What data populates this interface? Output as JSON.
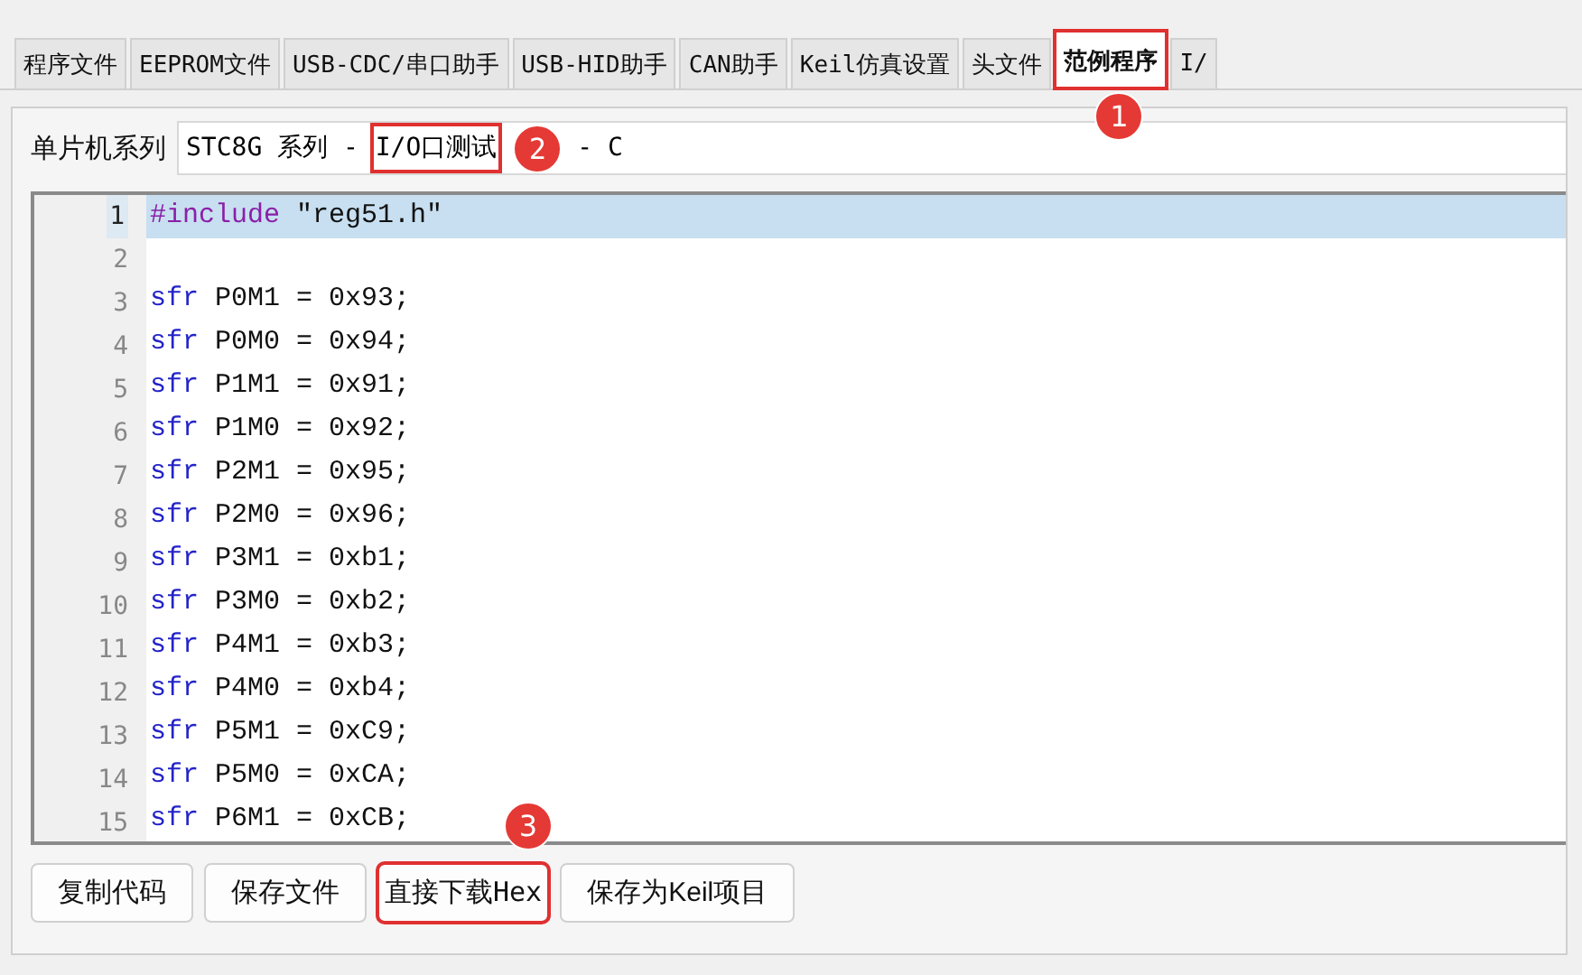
{
  "tabs": [
    {
      "label": "程序文件",
      "selected": false
    },
    {
      "label": "EEPROM文件",
      "selected": false
    },
    {
      "label": "USB-CDC/串口助手",
      "selected": false
    },
    {
      "label": "USB-HID助手",
      "selected": false
    },
    {
      "label": "CAN助手",
      "selected": false
    },
    {
      "label": "Keil仿真设置",
      "selected": false
    },
    {
      "label": "头文件",
      "selected": false
    },
    {
      "label": "范例程序",
      "selected": true,
      "callout": "1"
    },
    {
      "label": "I/",
      "selected": false
    }
  ],
  "series": {
    "label": "单片机系列",
    "parts": [
      {
        "text": "STC8G 系列 - "
      },
      {
        "text": "I/O口测试",
        "callout": "2"
      },
      {
        "text": " - C"
      }
    ]
  },
  "code": [
    {
      "number": "1",
      "selected": true,
      "tokens": [
        {
          "kind": "directive",
          "text": "#include"
        },
        {
          "kind": "plain",
          "text": " \"reg51.h\""
        }
      ]
    },
    {
      "number": "2",
      "selected": false
    },
    {
      "number": "3",
      "selected": false,
      "tokens": [
        {
          "kind": "keyword",
          "text": "sfr"
        },
        {
          "kind": "plain",
          "text": " P0M1 = 0x93;"
        }
      ]
    },
    {
      "number": "4",
      "selected": false,
      "tokens": [
        {
          "kind": "keyword",
          "text": "sfr"
        },
        {
          "kind": "plain",
          "text": " P0M0 = 0x94;"
        }
      ]
    },
    {
      "number": "5",
      "selected": false,
      "tokens": [
        {
          "kind": "keyword",
          "text": "sfr"
        },
        {
          "kind": "plain",
          "text": " P1M1 = 0x91;"
        }
      ]
    },
    {
      "number": "6",
      "selected": false,
      "tokens": [
        {
          "kind": "keyword",
          "text": "sfr"
        },
        {
          "kind": "plain",
          "text": " P1M0 = 0x92;"
        }
      ]
    },
    {
      "number": "7",
      "selected": false,
      "tokens": [
        {
          "kind": "keyword",
          "text": "sfr"
        },
        {
          "kind": "plain",
          "text": " P2M1 = 0x95;"
        }
      ]
    },
    {
      "number": "8",
      "selected": false,
      "tokens": [
        {
          "kind": "keyword",
          "text": "sfr"
        },
        {
          "kind": "plain",
          "text": " P2M0 = 0x96;"
        }
      ]
    },
    {
      "number": "9",
      "selected": false,
      "tokens": [
        {
          "kind": "keyword",
          "text": "sfr"
        },
        {
          "kind": "plain",
          "text": " P3M1 = 0xb1;"
        }
      ]
    },
    {
      "number": "10",
      "selected": false,
      "tokens": [
        {
          "kind": "keyword",
          "text": "sfr"
        },
        {
          "kind": "plain",
          "text": " P3M0 = 0xb2;"
        }
      ]
    },
    {
      "number": "11",
      "selected": false,
      "tokens": [
        {
          "kind": "keyword",
          "text": "sfr"
        },
        {
          "kind": "plain",
          "text": " P4M1 = 0xb3;"
        }
      ]
    },
    {
      "number": "12",
      "selected": false,
      "tokens": [
        {
          "kind": "keyword",
          "text": "sfr"
        },
        {
          "kind": "plain",
          "text": " P4M0 = 0xb4;"
        }
      ]
    },
    {
      "number": "13",
      "selected": false,
      "tokens": [
        {
          "kind": "keyword",
          "text": "sfr"
        },
        {
          "kind": "plain",
          "text": " P5M1 = 0xC9;"
        }
      ]
    },
    {
      "number": "14",
      "selected": false,
      "tokens": [
        {
          "kind": "keyword",
          "text": "sfr"
        },
        {
          "kind": "plain",
          "text": " P5M0 = 0xCA;"
        }
      ]
    },
    {
      "number": "15",
      "selected": false,
      "tokens": [
        {
          "kind": "keyword",
          "text": "sfr"
        },
        {
          "kind": "plain",
          "text": " P6M1 = 0xCB;"
        }
      ]
    }
  ],
  "buttons": [
    {
      "label": "复制代码"
    },
    {
      "label": "保存文件"
    },
    {
      "label": "直接下载Hex",
      "callout": "3"
    },
    {
      "label": "保存为Keil项目"
    }
  ]
}
